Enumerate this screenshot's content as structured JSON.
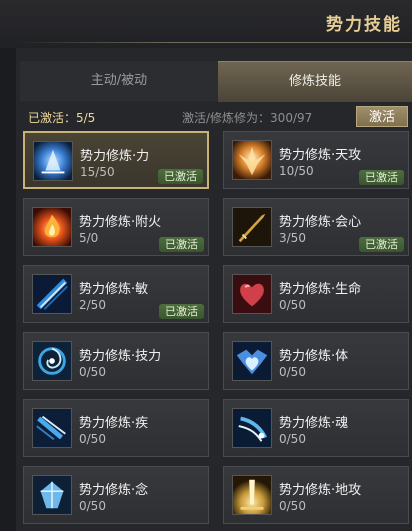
{
  "header": {
    "title": "势力技能"
  },
  "tabs": [
    {
      "label": "主动/被动",
      "active": false
    },
    {
      "label": "修炼技能",
      "active": true
    }
  ],
  "status": {
    "active_label": "已激活：5/5",
    "cultivation_label": "激活/修炼修为：300/97",
    "activate_button": "激活"
  },
  "badge_text": "已激活",
  "skills": [
    {
      "name": "势力修炼·力",
      "level": "15/50",
      "activated": true,
      "icon": "strength-icon",
      "color": "#3a7fd4"
    },
    {
      "name": "势力修炼·天攻",
      "level": "10/50",
      "activated": true,
      "icon": "sky-attack-icon",
      "color": "#d9822b"
    },
    {
      "name": "势力修炼·附火",
      "level": "5/0",
      "activated": true,
      "icon": "fire-icon",
      "color": "#e8551c"
    },
    {
      "name": "势力修炼·会心",
      "level": "3/50",
      "activated": true,
      "icon": "critical-sword-icon",
      "color": "#d6a546"
    },
    {
      "name": "势力修炼·敏",
      "level": "2/50",
      "activated": true,
      "icon": "agility-icon",
      "color": "#2f8be0"
    },
    {
      "name": "势力修炼·生命",
      "level": "0/50",
      "activated": false,
      "icon": "heart-icon",
      "color": "#d0404a"
    },
    {
      "name": "势力修炼·技力",
      "level": "0/50",
      "activated": false,
      "icon": "vortex-icon",
      "color": "#3fa6e6"
    },
    {
      "name": "势力修炼·体",
      "level": "0/50",
      "activated": false,
      "icon": "body-shield-icon",
      "color": "#4a8fe0"
    },
    {
      "name": "势力修炼·疾",
      "level": "0/50",
      "activated": false,
      "icon": "speed-icon",
      "color": "#4aa8ee"
    },
    {
      "name": "势力修炼·魂",
      "level": "0/50",
      "activated": false,
      "icon": "soul-icon",
      "color": "#5fb6f0"
    },
    {
      "name": "势力修炼·念",
      "level": "0/50",
      "activated": false,
      "icon": "crystal-icon",
      "color": "#6fb8ea"
    },
    {
      "name": "势力修炼·地攻",
      "level": "0/50",
      "activated": false,
      "icon": "earth-attack-icon",
      "color": "#c79a3a"
    }
  ]
}
